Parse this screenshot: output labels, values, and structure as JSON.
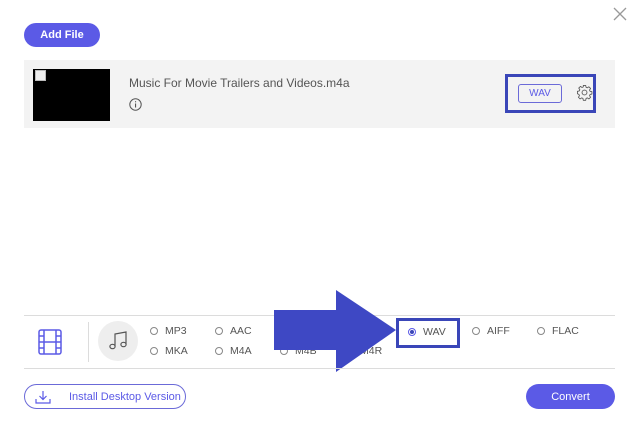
{
  "toolbar": {
    "add_file_label": "Add File"
  },
  "file": {
    "name": "Music For Movie Trailers and Videos.m4a",
    "output_format": "WAV"
  },
  "format_options": {
    "row1": [
      "MP3",
      "AAC",
      "WAV",
      "AIFF",
      "FLAC"
    ],
    "row2": [
      "MKA",
      "M4A",
      "M4B",
      "M4R"
    ],
    "selected": "WAV"
  },
  "footer": {
    "install_label": "Install Desktop Version",
    "convert_label": "Convert"
  },
  "colors": {
    "accent": "#5b5ae6",
    "highlight": "#3a46b8",
    "arrow": "#3e48c4"
  }
}
